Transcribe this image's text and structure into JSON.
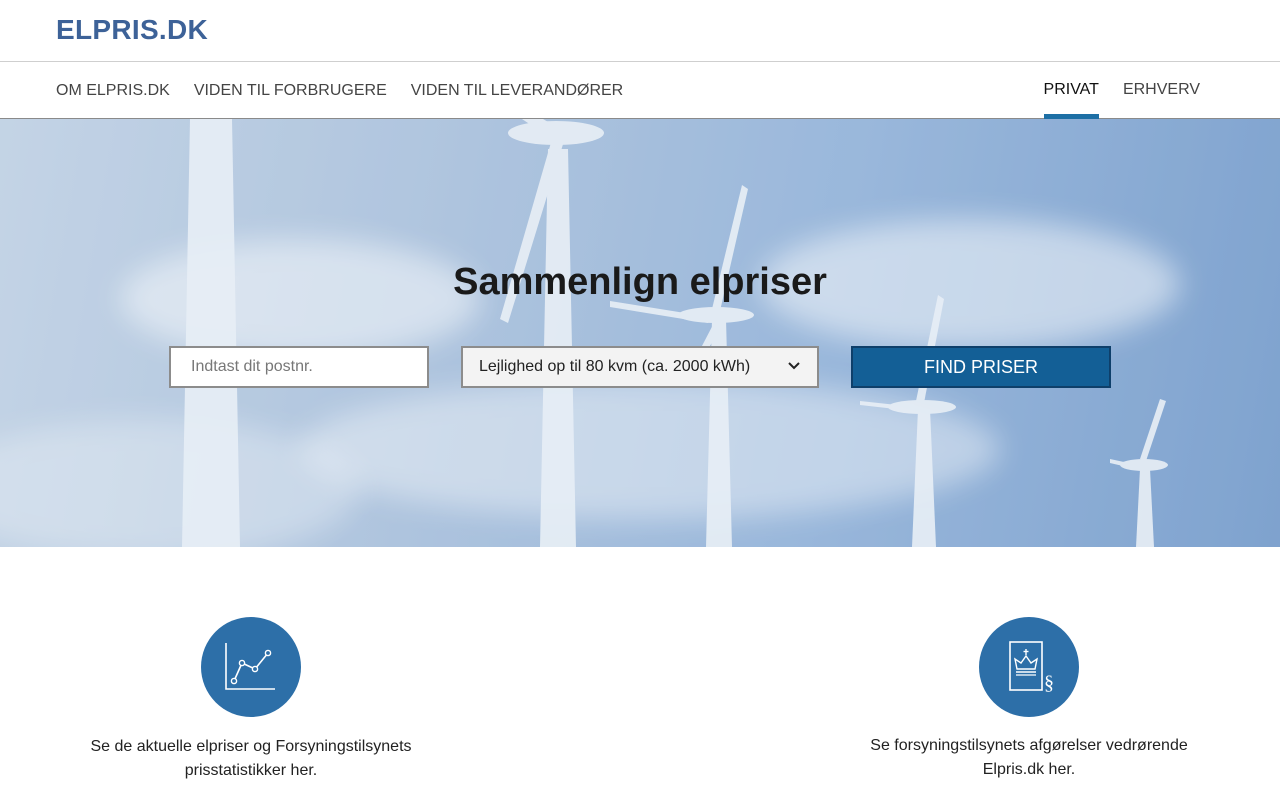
{
  "header": {
    "logo": "ELPRIS.DK"
  },
  "nav": {
    "left": [
      "OM ELPRIS.DK",
      "VIDEN TIL FORBRUGERE",
      "VIDEN TIL LEVERANDØRER"
    ],
    "right": [
      "PRIVAT",
      "ERHVERV"
    ],
    "active": "PRIVAT"
  },
  "hero": {
    "title": "Sammenlign elpriser",
    "zip_placeholder": "Indtast dit postnr.",
    "zip_value": "",
    "housing_selected": "Lejlighed op til 80 kvm (ca. 2000 kWh)",
    "find_button": "FIND PRISER"
  },
  "features": [
    {
      "icon": "line-chart-icon",
      "text": "Se de aktuelle elpriser og Forsyningstilsynets prisstatistikker her."
    },
    {
      "icon": "crown-document-icon",
      "text": "Se forsyningstilsynets afgørelser vedrørende Elpris.dk her."
    }
  ],
  "colors": {
    "brand": "#3d6298",
    "accent": "#1d6fa5",
    "button": "#135f96",
    "icon_circle": "#2d6fa8"
  }
}
